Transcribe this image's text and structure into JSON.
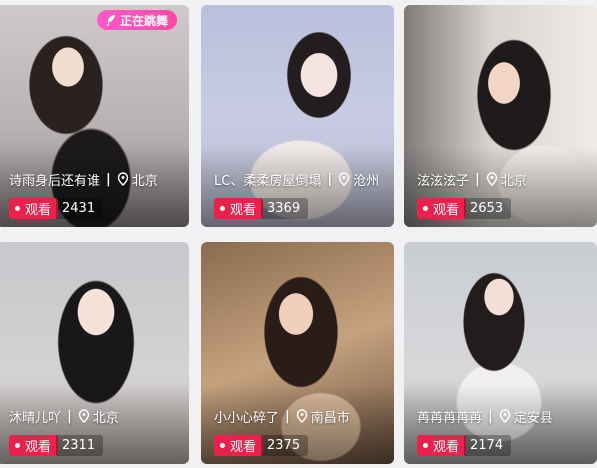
{
  "cards": [
    {
      "name": "诗雨身后还有谁",
      "location": "北京",
      "watch_label": "观看",
      "viewers": "2431",
      "badge": "正在跳舞"
    },
    {
      "name": "LC、柔柔房屋倒塌",
      "location": "沧州",
      "watch_label": "观看",
      "viewers": "3369"
    },
    {
      "name": "泫泫泫子",
      "location": "北京",
      "watch_label": "观看",
      "viewers": "2653"
    },
    {
      "name": "沐晴儿吖",
      "location": "北京",
      "watch_label": "观看",
      "viewers": "2311"
    },
    {
      "name": "小小心碎了",
      "location": "南昌市",
      "watch_label": "观看",
      "viewers": "2375"
    },
    {
      "name": "苒苒苒苒苒",
      "location": "定安县",
      "watch_label": "观看",
      "viewers": "2174"
    }
  ],
  "colors": {
    "watch_badge": "#e8224d",
    "dance_badge": "#ff59c9"
  },
  "icons": {
    "location": "location-pin-icon",
    "dance": "feather-icon"
  }
}
